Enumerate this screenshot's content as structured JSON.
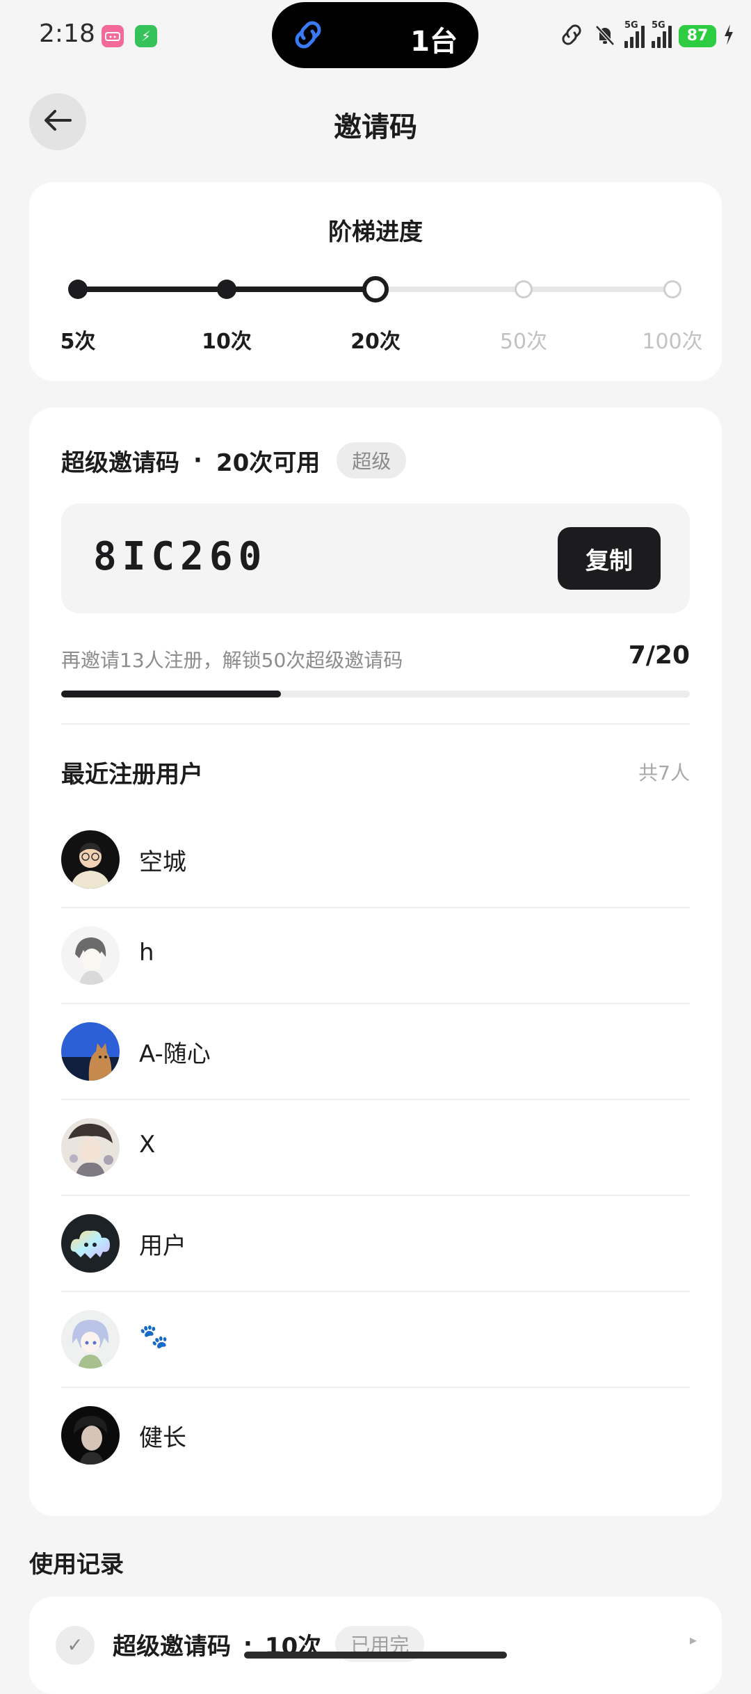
{
  "status_bar": {
    "time": "2:18",
    "app_icon_1": "bilibili",
    "app_icon_2": "⚡",
    "island_count": "1台",
    "network_1": "5G",
    "network_2": "5G",
    "battery": "87"
  },
  "header": {
    "title": "邀请码"
  },
  "tier": {
    "title": "阶梯进度",
    "steps": [
      {
        "label": "5次",
        "state": "done"
      },
      {
        "label": "10次",
        "state": "done"
      },
      {
        "label": "20次",
        "state": "current"
      },
      {
        "label": "50次",
        "state": "todo"
      },
      {
        "label": "100次",
        "state": "todo"
      }
    ]
  },
  "invite": {
    "title": "超级邀请码",
    "separator": "·",
    "availability": "20次可用",
    "badge": "超级",
    "code": "8IC260",
    "copy_label": "复制",
    "hint": "再邀请13人注册，解锁50次超级邀请码",
    "progress_text": "7/20",
    "progress_fraction": 0.35
  },
  "recent": {
    "title": "最近注册用户",
    "total": "共7人",
    "users": [
      {
        "name": "空城"
      },
      {
        "name": "h"
      },
      {
        "name": "A-随心"
      },
      {
        "name": "X"
      },
      {
        "name": "用户"
      },
      {
        "name": "🐾"
      },
      {
        "name": "健长"
      }
    ]
  },
  "usage": {
    "title": "使用记录",
    "records": [
      {
        "check": "✓",
        "title": "超级邀请码",
        "separator": "·",
        "count": "10次",
        "status": "已用完",
        "arrow": "▸"
      }
    ]
  },
  "colors": {
    "accent": "#1c1c1e",
    "background": "#f5f5f5",
    "battery": "#2ecc40"
  }
}
